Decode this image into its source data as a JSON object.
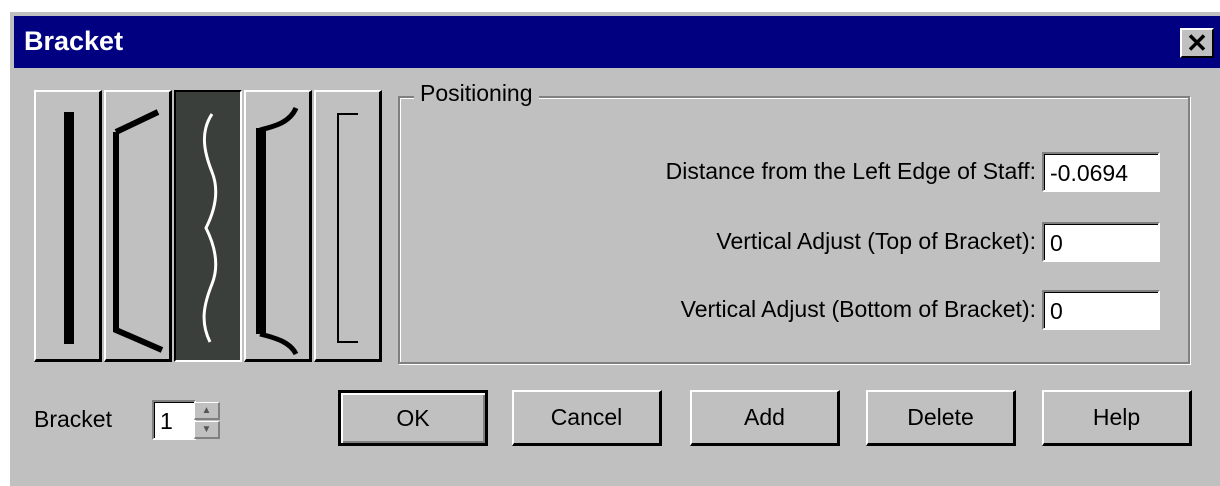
{
  "window": {
    "title": "Bracket",
    "close_glyph": "✕"
  },
  "bracket_styles": {
    "items": [
      {
        "name": "thick-line-icon",
        "selected": false
      },
      {
        "name": "bracket-with-hooks-icon",
        "selected": false
      },
      {
        "name": "curly-brace-icon",
        "selected": true
      },
      {
        "name": "thick-bracket-icon",
        "selected": false
      },
      {
        "name": "thin-bracket-icon",
        "selected": false
      }
    ]
  },
  "positioning": {
    "group_label": "Positioning",
    "distance_label": "Distance from the Left Edge of Staff:",
    "distance_value": "-0.0694",
    "vtop_label": "Vertical Adjust (Top of Bracket):",
    "vtop_value": "0",
    "vbottom_label": "Vertical Adjust (Bottom of Bracket):",
    "vbottom_value": "0"
  },
  "bracket_spinner": {
    "label": "Bracket",
    "value": "1"
  },
  "buttons": {
    "ok": "OK",
    "cancel": "Cancel",
    "add": "Add",
    "delete": "Delete",
    "help": "Help"
  },
  "colors": {
    "titlebar": "#000080",
    "face": "#c0c0c0",
    "selected": "#3a3f3b"
  }
}
